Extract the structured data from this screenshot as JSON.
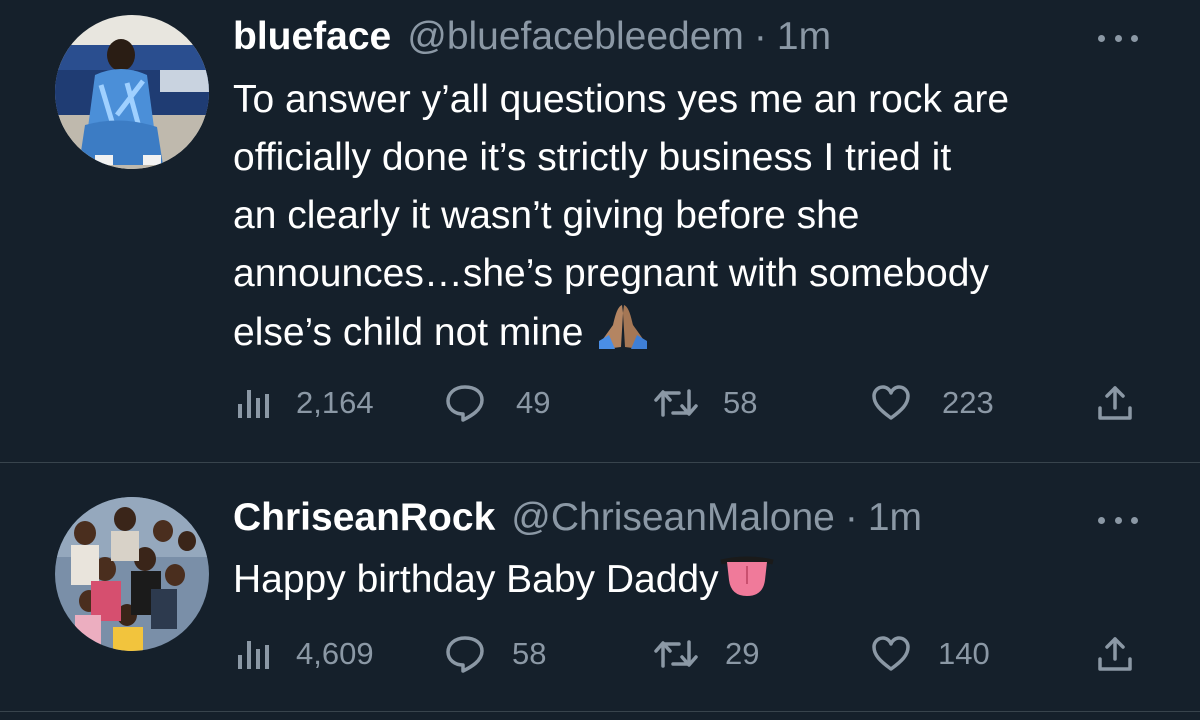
{
  "tweets": [
    {
      "display_name": "blueface",
      "handle": "@bluefacebleedem",
      "separator": "·",
      "time": "1m",
      "text_lines": [
        "To answer y’all questions yes me an rock are",
        "officially done it’s strictly business I tried it",
        "an clearly it wasn’t giving before she",
        "announces…she’s pregnant with somebody",
        "else’s child not mine"
      ],
      "trailing_emoji": "folded-hands-emoji",
      "views": "2,164",
      "replies": "49",
      "retweets": "58",
      "likes": "223"
    },
    {
      "display_name": "ChriseanRock",
      "handle": "@ChriseanMalone",
      "separator": "·",
      "time": "1m",
      "text_lines": [
        "Happy birthday Baby Daddy"
      ],
      "trailing_emoji": "tongue-emoji",
      "views": "4,609",
      "replies": "58",
      "retweets": "29",
      "likes": "140"
    }
  ],
  "icons": {
    "views": "analytics-icon",
    "reply": "comment-bubble-icon",
    "retweet": "retweet-icon",
    "like": "heart-icon",
    "share": "share-upload-icon",
    "more": "more-dots-icon"
  },
  "colors": {
    "background": "#15202b",
    "text": "#ffffff",
    "secondary_text": "#8b98a5",
    "divider": "#38444d"
  }
}
